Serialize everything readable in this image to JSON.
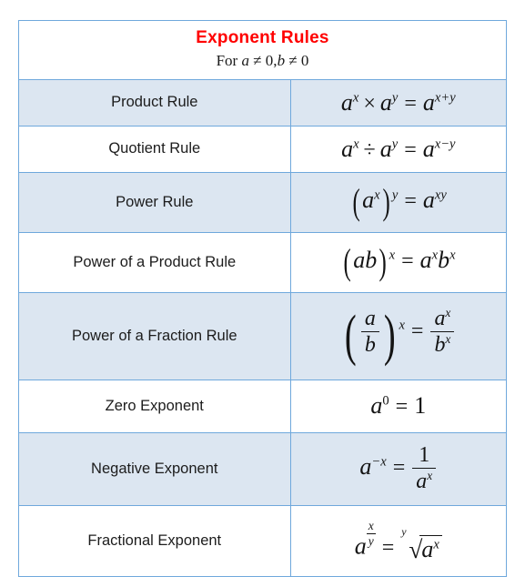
{
  "header": {
    "title": "Exponent Rules",
    "subtitle_prefix": "For ",
    "subtitle_cond1_var": "a",
    "subtitle_cond1_rest": " ≠ 0,",
    "subtitle_cond2_var": "b",
    "subtitle_cond2_rest": " ≠ 0"
  },
  "colors": {
    "title": "#FF0000",
    "border": "#6FA8DC",
    "row_shaded": "#DCE6F1",
    "row_plain": "#FFFFFF",
    "text": "#1C1C1C"
  },
  "rows": [
    {
      "label": "Product Rule",
      "formula_text": "a^x × a^y = a^(x+y)",
      "shaded": true,
      "base": "a",
      "exp1": "x",
      "exp2": "y",
      "operator": "×",
      "equals": "=",
      "result_base": "a",
      "result_exp": "x+y"
    },
    {
      "label": "Quotient Rule",
      "formula_text": "a^x ÷ a^y = a^(x−y)",
      "shaded": false,
      "base": "a",
      "exp1": "x",
      "exp2": "y",
      "operator": "÷",
      "equals": "=",
      "result_base": "a",
      "result_exp": "x−y"
    },
    {
      "label": "Power Rule",
      "formula_text": "(a^x)^y = a^(xy)",
      "shaded": true,
      "base": "a",
      "inner_exp": "x",
      "outer_exp": "y",
      "equals": "=",
      "result_base": "a",
      "result_exp": "xy"
    },
    {
      "label": "Power of a Product Rule",
      "formula_text": "(ab)^x = a^x b^x",
      "shaded": false,
      "base_a": "a",
      "base_b": "b",
      "outer_exp": "x",
      "equals": "=",
      "result_exp": "x"
    },
    {
      "label": "Power of a Fraction Rule",
      "formula_text": "(a/b)^x = a^x / b^x",
      "shaded": true,
      "num": "a",
      "den": "b",
      "outer_exp": "x",
      "equals": "=",
      "result_num": "a",
      "result_den": "b",
      "result_exp": "x"
    },
    {
      "label": "Zero Exponent",
      "formula_text": "a^0 = 1",
      "shaded": false,
      "base": "a",
      "exp": "0",
      "equals": "=",
      "result": "1"
    },
    {
      "label": "Negative Exponent",
      "formula_text": "a^(−x) = 1 / a^x",
      "shaded": true,
      "base": "a",
      "exp": "−x",
      "equals": "=",
      "result_num": "1",
      "result_den_base": "a",
      "result_den_exp": "x"
    },
    {
      "label": "Fractional Exponent",
      "formula_text": "a^(x/y) = ʸ√(a^x)",
      "shaded": false,
      "base": "a",
      "exp_num": "x",
      "exp_den": "y",
      "equals": "=",
      "radical_index": "y",
      "radical_sign": "√",
      "radicand_base": "a",
      "radicand_exp": "x"
    }
  ]
}
